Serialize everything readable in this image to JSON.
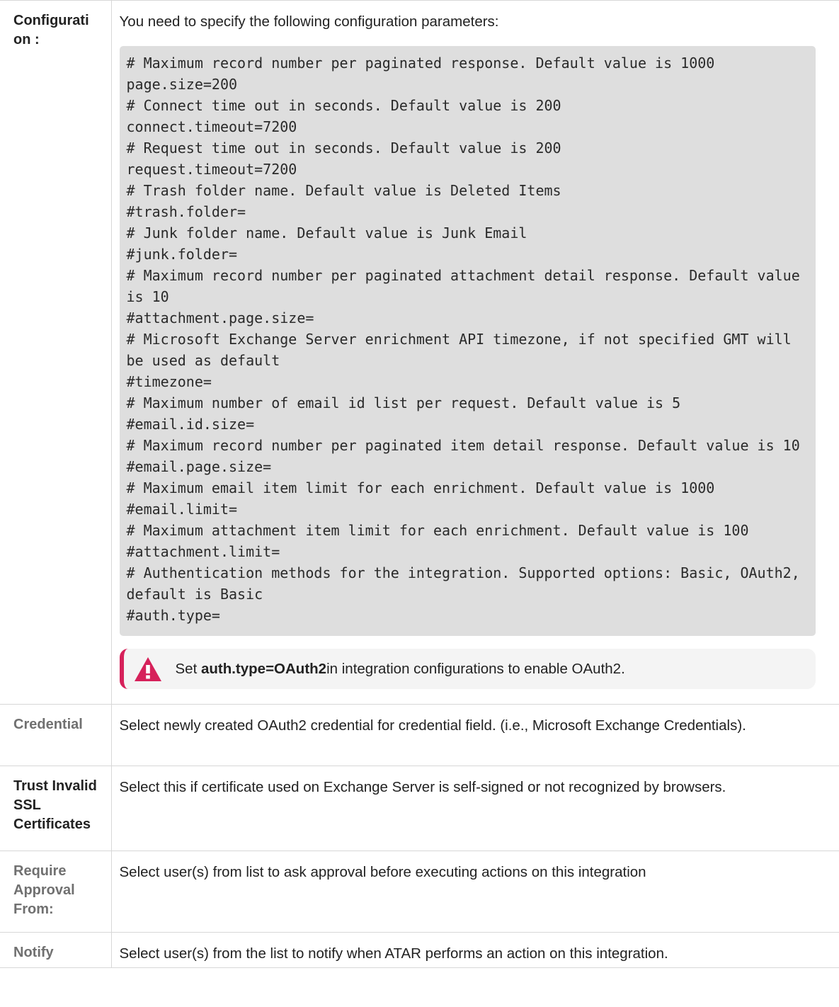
{
  "rows": [
    {
      "label": "Configurati on :",
      "description": "You need to specify the following configuration parameters:",
      "code": "# Maximum record number per paginated response. Default value is 1000\npage.size=200\n# Connect time out in seconds. Default value is 200\nconnect.timeout=7200\n# Request time out in seconds. Default value is 200\nrequest.timeout=7200\n# Trash folder name. Default value is Deleted Items\n#trash.folder=\n# Junk folder name. Default value is Junk Email\n#junk.folder=\n# Maximum record number per paginated attachment detail response. Default value is 10\n#attachment.page.size=\n# Microsoft Exchange Server enrichment API timezone, if not specified GMT will be used as default\n#timezone=\n# Maximum number of email id list per request. Default value is 5\n#email.id.size=\n# Maximum record number per paginated item detail response. Default value is 10\n#email.page.size=\n# Maximum email item limit for each enrichment. Default value is 1000\n#email.limit=\n# Maximum attachment item limit for each enrichment. Default value is 100\n#attachment.limit=\n# Authentication methods for the integration. Supported options: Basic, OAuth2, default is Basic\n#auth.type=",
      "callout": {
        "prefix": "Set ",
        "bold": "auth.type=OAuth2",
        "suffix": "in integration configurations to enable OAuth2.",
        "icon": "warning-icon",
        "accent_color": "#d6215a"
      }
    },
    {
      "label": "Credential",
      "description": "Select newly created OAuth2 credential for credential field. (i.e., Microsoft Exchange Credentials)."
    },
    {
      "label": "Trust Invalid SSL Certificates",
      "description": "Select this if certificate used on Exchange Server is self-signed or not recognized by browsers."
    },
    {
      "label": "Require Approval From:",
      "description": "Select user(s) from list to ask approval before executing actions on this integration"
    },
    {
      "label": "Notify",
      "description": "Select user(s) from the list to notify when ATAR performs an action on this integration."
    }
  ]
}
